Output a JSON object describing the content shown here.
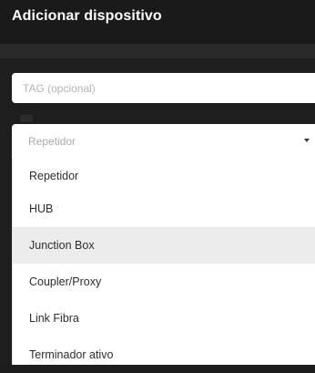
{
  "dialog": {
    "title": "Adicionar dispositivo"
  },
  "form": {
    "tag_placeholder": "TAG (opcional)",
    "device_type": {
      "selected": "Repetidor",
      "options": [
        {
          "label": "Repetidor",
          "highlighted": false
        },
        {
          "label": "HUB",
          "highlighted": false
        },
        {
          "label": "Junction Box",
          "highlighted": true
        },
        {
          "label": "Coupler/Proxy",
          "highlighted": false
        },
        {
          "label": "Link Fibra",
          "highlighted": false
        },
        {
          "label": "Terminador ativo",
          "highlighted": false
        }
      ]
    }
  },
  "colors": {
    "header_bg": "#1a1a1a",
    "page_bg": "#1e1e1e",
    "highlight_bg": "#ececec"
  }
}
